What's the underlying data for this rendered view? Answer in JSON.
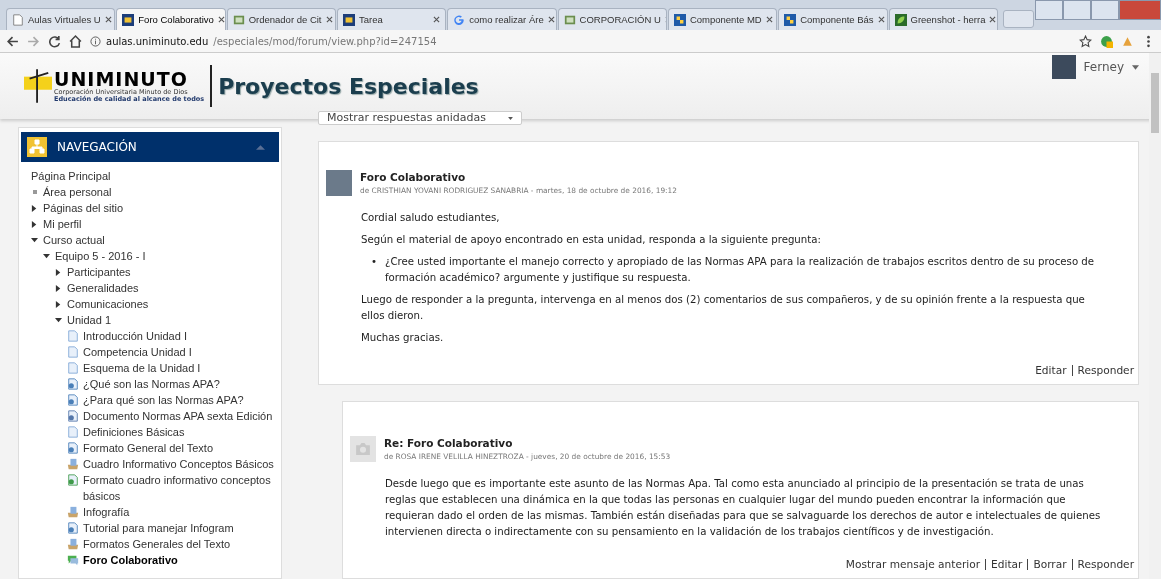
{
  "browser": {
    "tabs": [
      {
        "title": "Aulas Virtuales U",
        "selected": false,
        "kind": "page"
      },
      {
        "title": "Foro Colaborativo",
        "selected": true,
        "kind": "site"
      },
      {
        "title": "Ordenador de Cit",
        "selected": false,
        "kind": "doc"
      },
      {
        "title": "Tarea",
        "selected": false,
        "kind": "site"
      },
      {
        "title": "como realizar Áre",
        "selected": false,
        "kind": "google"
      },
      {
        "title": "CORPORACIÓN U",
        "selected": false,
        "kind": "doc"
      },
      {
        "title": "Componente MD",
        "selected": false,
        "kind": "puzzle"
      },
      {
        "title": "Componente Bás",
        "selected": false,
        "kind": "puzzle"
      },
      {
        "title": "Greenshot - herra",
        "selected": false,
        "kind": "green"
      }
    ],
    "url_host": "aulas.uniminuto.edu",
    "url_path": "/especiales/mod/forum/view.php?id=247154"
  },
  "header": {
    "logo_name": "UNIMINUTO",
    "logo_line_1": "Corporación Universitaria Minuto de Dios",
    "logo_line_2": "Educación de calidad al alcance de todos",
    "site_title": "Proyectos Especiales",
    "user_name": "Ferney"
  },
  "navigation": {
    "title": "NAVEGACIÓN",
    "tree": [
      {
        "label": "Página Principal",
        "kind": "link"
      },
      {
        "label": "Área personal",
        "kind": "leaf"
      },
      {
        "label": "Páginas del sitio",
        "kind": "branch",
        "expanded": false
      },
      {
        "label": "Mi perfil",
        "kind": "branch",
        "expanded": false
      },
      {
        "label": "Curso actual",
        "kind": "branch",
        "expanded": true,
        "children": [
          {
            "label": "Equipo 5 - 2016 - I",
            "kind": "branch",
            "expanded": true,
            "children": [
              {
                "label": "Participantes",
                "kind": "branch",
                "expanded": false
              },
              {
                "label": "Generalidades",
                "kind": "branch",
                "expanded": false
              },
              {
                "label": "Comunicaciones",
                "kind": "branch",
                "expanded": false
              },
              {
                "label": "Unidad 1",
                "kind": "branch",
                "expanded": true,
                "children": [
                  {
                    "label": "Introducción Unidad I",
                    "kind": "page",
                    "selected": false
                  },
                  {
                    "label": "Competencia Unidad I",
                    "kind": "page",
                    "selected": false
                  },
                  {
                    "label": "Esquema de la Unidad I",
                    "kind": "page",
                    "selected": false
                  },
                  {
                    "label": "¿Qué son las Normas APA?",
                    "kind": "url",
                    "selected": false
                  },
                  {
                    "label": "¿Para qué son las Normas APA?",
                    "kind": "url",
                    "selected": false
                  },
                  {
                    "label": "Documento Normas APA sexta Edición",
                    "kind": "file",
                    "selected": false
                  },
                  {
                    "label": "Definiciones Básicas",
                    "kind": "page",
                    "selected": false
                  },
                  {
                    "label": "Formato General del Texto",
                    "kind": "url",
                    "selected": false
                  },
                  {
                    "label": "Cuadro Informativo Conceptos Básicos",
                    "kind": "assign",
                    "selected": false
                  },
                  {
                    "label": "Formato cuadro informativo conceptos básicos",
                    "kind": "sheet",
                    "selected": false
                  },
                  {
                    "label": "Infografía",
                    "kind": "assign",
                    "selected": false
                  },
                  {
                    "label": "Tutorial para manejar Infogram",
                    "kind": "url",
                    "selected": false
                  },
                  {
                    "label": "Formatos Generales del Texto",
                    "kind": "assign",
                    "selected": false
                  },
                  {
                    "label": "Foro Colaborativo",
                    "kind": "forum",
                    "selected": true
                  }
                ]
              }
            ]
          }
        ]
      }
    ]
  },
  "display_mode": "Mostrar respuestas anidadas",
  "posts": [
    {
      "kind": "discussion",
      "subject": "Foro Colaborativo",
      "byline": "de CRISTHIAN YOVANI RODRIGUEZ SANABRIA - martes, 18 de octubre de 2016, 19:12",
      "content": [
        {
          "kind": "p",
          "text": "Cordial saludo estudiantes,"
        },
        {
          "kind": "p",
          "text": "Según el material de apoyo encontrado en esta unidad, responda a la siguiente pregunta:"
        },
        {
          "kind": "bullet",
          "marker": "•",
          "text": "¿Cree usted importante el manejo correcto y apropiado de las Normas APA para la realización de trabajos escritos dentro de su proceso de formación académico? argumente y justifique su respuesta."
        },
        {
          "kind": "p",
          "text": "Luego de responder a la pregunta, intervenga en al menos dos (2) comentarios de sus compañeros, y de su opinión frente a la respuesta que ellos dieron."
        },
        {
          "kind": "p",
          "text": "Muchas gracias."
        }
      ],
      "actions": [
        "Editar",
        "Responder"
      ]
    },
    {
      "kind": "reply",
      "subject": "Re: Foro Colaborativo",
      "byline": "de ROSA IRENE VELILLA HINEZTROZA - jueves, 20 de octubre de 2016, 15:53",
      "content": [
        {
          "kind": "p",
          "text": "Desde luego que es importante este asunto de las Normas Apa. Tal como esta anunciado al principio de la presentación se trata de unas reglas que establecen una dinámica en la que todas las personas en cualquier lugar del mundo pueden encontrar la información que requieran dado el orden de las mismas. También están diseñadas para que se salvaguarde los derechos de autor e intelectuales de quienes intervienen directa o indirectamente con su pensamiento en la validación de los trabajos científicos y de investigación."
        }
      ],
      "actions": [
        "Mostrar mensaje anterior",
        "Editar",
        "Borrar",
        "Responder"
      ]
    }
  ]
}
